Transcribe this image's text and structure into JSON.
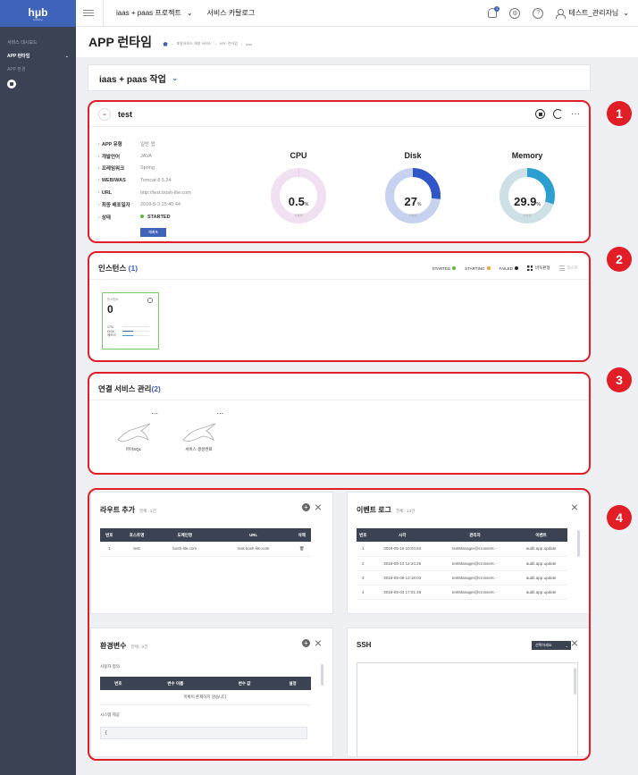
{
  "brand": {
    "logo_text": "hμb",
    "logo_sub": "HubPop"
  },
  "sidebar": {
    "items": [
      {
        "label": "서비스 대시보드"
      },
      {
        "label": "APP 런타임"
      },
      {
        "label": "APP 환경"
      }
    ]
  },
  "topbar": {
    "project": "iaas + paas 프로젝트",
    "catalog": "서비스 카탈로그",
    "notification_count": "1",
    "help": "?",
    "user": "테스트_관리자님"
  },
  "page": {
    "title": "APP 런타임",
    "breadcrumb": [
      "포탈서비스 개발 서비스",
      "APP 런타임",
      "test"
    ]
  },
  "project_card": {
    "label": "iaas + paas 작업"
  },
  "app": {
    "name": "test",
    "info": [
      {
        "k": "APP 유형",
        "v": "일반 앱"
      },
      {
        "k": "개발언어",
        "v": "JAVA"
      },
      {
        "k": "프레임워크",
        "v": "Spring"
      },
      {
        "k": "WEB/WAS",
        "v": "Tomcat 8.5.24"
      },
      {
        "k": "URL",
        "v": "http://test.bosh-lite.com"
      },
      {
        "k": "최종 배포일자",
        "v": "2018-5-3 15:40:44"
      },
      {
        "k": "상태",
        "v": "STARTED"
      }
    ],
    "restart_label": "재배포",
    "gauges": [
      {
        "title": "CPU",
        "value": "0.5",
        "unit": "%",
        "fraction": 0.005,
        "sub": "사용량",
        "color": "#e9c8ea",
        "track": "#f1e0f2"
      },
      {
        "title": "Disk",
        "value": "27",
        "unit": "%",
        "fraction": 0.27,
        "sub": "사용량",
        "color": "#2f55c9",
        "track": "#c6d2f0"
      },
      {
        "title": "Memory",
        "value": "29.9",
        "unit": "%",
        "fraction": 0.299,
        "sub": "사용량",
        "color": "#2a9fd0",
        "track": "#cde0e6"
      }
    ]
  },
  "instances": {
    "title": "인스턴스",
    "count": "(1)",
    "legend": [
      {
        "label": "STARTED",
        "color": "#5bb830"
      },
      {
        "label": "STARTING",
        "color": "#f2a22c"
      },
      {
        "label": "FAILED",
        "color": "#222222"
      }
    ],
    "view_grid": "바둑판형",
    "view_list": "리스트",
    "box": {
      "label": "인스턴스",
      "index": "0",
      "bars": [
        {
          "k": "CPU",
          "fill": 0,
          "color": "#3e63b8"
        },
        {
          "k": "DISK",
          "fill": 0.4,
          "color": "#3e63b8"
        },
        {
          "k": "메모리",
          "fill": 0.4,
          "color": "#2a9fd0"
        }
      ]
    }
  },
  "services": {
    "title": "연결 서비스 관리",
    "count": "(2)",
    "items": [
      {
        "name": "마이SQL",
        "more": "..."
      },
      {
        "name": "서비스 생성완료",
        "more": "..."
      }
    ]
  },
  "routes": {
    "title": "라우트 추가",
    "total": "전체 : 1건",
    "headers": [
      "번호",
      "호스트명",
      "도메인명",
      "URL",
      "삭제"
    ],
    "rows": [
      [
        "1",
        "test",
        "bosh-lite.com",
        "test.bosh-lite.com",
        "🗑"
      ]
    ]
  },
  "events": {
    "title": "이벤트 로그",
    "total": "전체 : 13건",
    "headers": [
      "번호",
      "시각",
      "관리자",
      "이벤트"
    ],
    "rows": [
      [
        "1",
        "2018-05-16 10:04:54",
        "testManager@crossent.··",
        "audit.app.update"
      ],
      [
        "2",
        "2018-05-14 12:24:25",
        "testManager@crossent.··",
        "audit.app.update"
      ],
      [
        "3",
        "2018-05-08 13:18:03",
        "testManager@crossent.··",
        "audit.app.update"
      ],
      [
        "4",
        "2018-05-03 17:01:48",
        "testManager@crossent.··",
        "audit.app.update"
      ]
    ]
  },
  "env": {
    "title": "환경변수",
    "total": "전체 : 0건",
    "user_defined": "사용자 정의",
    "headers": [
      "번호",
      "변수 이름",
      "변수 값",
      "설정"
    ],
    "empty": "목록이 존재하지 않습니다.",
    "system_provided": "시스템 제공",
    "system_value": "{"
  },
  "ssh": {
    "title": "SSH",
    "select": "선택하세요"
  },
  "markers": [
    "1",
    "2",
    "3",
    "4"
  ]
}
